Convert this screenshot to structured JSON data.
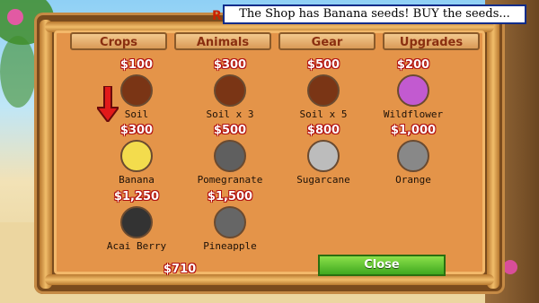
{
  "header": {
    "partial_title_letter": "R",
    "banner_text": "The Shop has Banana seeds! BUY the seeds..."
  },
  "tabs": [
    {
      "label": "Crops"
    },
    {
      "label": "Animals"
    },
    {
      "label": "Gear"
    },
    {
      "label": "Upgrades"
    }
  ],
  "items": [
    {
      "price": "$100",
      "name": "Soil",
      "icon": "soil-icon"
    },
    {
      "price": "$300",
      "name": "Soil x 3",
      "icon": "soil-icon"
    },
    {
      "price": "$500",
      "name": "Soil x 5",
      "icon": "soil-icon"
    },
    {
      "price": "$200",
      "name": "Wildflower",
      "icon": "wildflower-icon"
    },
    {
      "price": "$300",
      "name": "Banana",
      "icon": "banana-icon"
    },
    {
      "price": "$500",
      "name": "Pomegranate",
      "icon": "pomegranate-icon"
    },
    {
      "price": "$800",
      "name": "Sugarcane",
      "icon": "sugarcane-icon"
    },
    {
      "price": "$1,000",
      "name": "Orange",
      "icon": "orange-icon"
    },
    {
      "price": "$1,250",
      "name": "Acai Berry",
      "icon": "acai-berry-icon"
    },
    {
      "price": "$1,500",
      "name": "Pineapple",
      "icon": "pineapple-icon"
    }
  ],
  "footer": {
    "money": "$710",
    "close_label": "Close"
  },
  "colors": {
    "panel": "#e49449",
    "price_outline": "#b01010",
    "tab_text": "#8a2f10",
    "close_button": "#3fa81f"
  }
}
